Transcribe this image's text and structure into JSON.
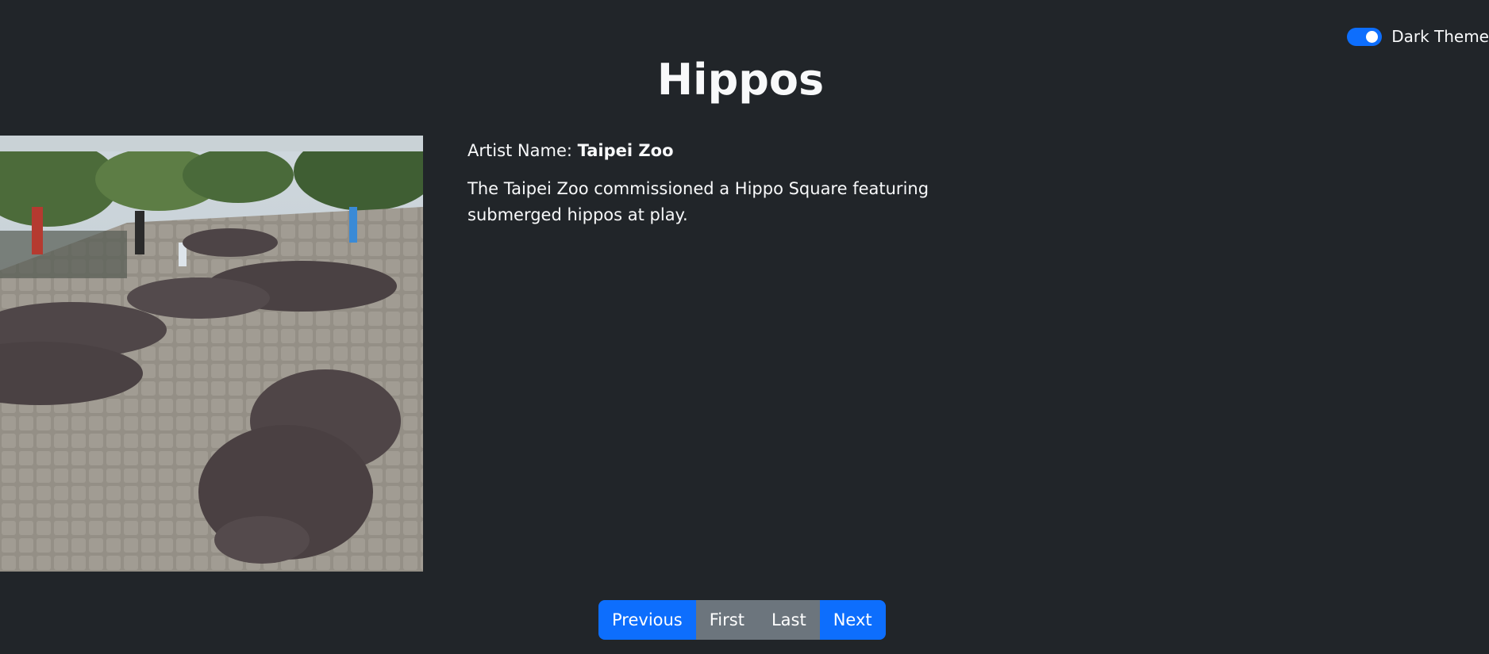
{
  "theme_toggle": {
    "label": "Dark Theme",
    "on": true,
    "accent_color": "#0d6efd"
  },
  "page": {
    "title": "Hippos"
  },
  "artwork": {
    "image_description_icon": "hippo-sculptures-photo"
  },
  "details": {
    "artist_label": "Artist Name:",
    "artist_name": "Taipei Zoo",
    "description": "The Taipei Zoo commissioned a Hippo Square featuring submerged hippos at play."
  },
  "pagination": {
    "previous": "Previous",
    "first": "First",
    "last": "Last",
    "next": "Next"
  },
  "colors": {
    "background": "#212529",
    "primary": "#0d6efd",
    "secondary": "#6c757d"
  }
}
